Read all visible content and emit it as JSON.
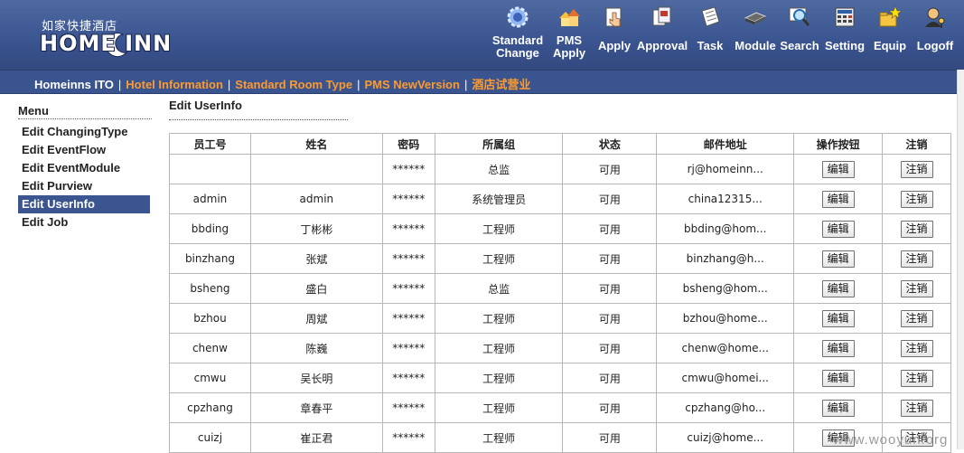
{
  "header": {
    "logo_cn": "如家快捷酒店",
    "logo_en": "HOME INN",
    "nav": [
      {
        "label": "Standard\nChange",
        "icon": "gear-icon"
      },
      {
        "label": "PMS\nApply",
        "icon": "houses-icon"
      },
      {
        "label": "Apply",
        "icon": "hand-pointer-icon"
      },
      {
        "label": "Approval",
        "icon": "documents-icon"
      },
      {
        "label": "Task",
        "icon": "notepad-icon"
      },
      {
        "label": "Module",
        "icon": "chip-icon"
      },
      {
        "label": "Search",
        "icon": "magnifier-icon"
      },
      {
        "label": "Setting",
        "icon": "calculator-icon"
      },
      {
        "label": "Equip",
        "icon": "folder-star-icon"
      },
      {
        "label": "Logoff",
        "icon": "user-key-icon"
      }
    ]
  },
  "subnav": {
    "items": [
      {
        "label": "Homeinns ITO",
        "style": "white"
      },
      {
        "label": "Hotel Information",
        "style": "orange"
      },
      {
        "label": "Standard Room Type",
        "style": "orange"
      },
      {
        "label": "PMS NewVersion",
        "style": "orange"
      },
      {
        "label": "酒店试营业",
        "style": "orange"
      }
    ],
    "separator": "|"
  },
  "menu": {
    "title": "Menu",
    "items": [
      "Edit ChangingType",
      "Edit EventFlow",
      "Edit EventModule",
      "Edit Purview",
      "Edit UserInfo",
      "Edit Job"
    ],
    "active_index": 4
  },
  "main": {
    "title": "Edit UserInfo",
    "columns": [
      "员工号",
      "姓名",
      "密码",
      "所属组",
      "状态",
      "邮件地址",
      "操作按钮",
      "注销"
    ],
    "edit_label": "编辑",
    "logout_label": "注销",
    "rows": [
      {
        "id": "",
        "name": "",
        "password": "******",
        "group": "总监",
        "status": "可用",
        "email": "rj@homeinn..."
      },
      {
        "id": "admin",
        "name": "admin",
        "password": "******",
        "group": "系统管理员",
        "status": "可用",
        "email": "china12315..."
      },
      {
        "id": "bbding",
        "name": "丁彬彬",
        "password": "******",
        "group": "工程师",
        "status": "可用",
        "email": "bbding@hom..."
      },
      {
        "id": "binzhang",
        "name": "张斌",
        "password": "******",
        "group": "工程师",
        "status": "可用",
        "email": "binzhang@h..."
      },
      {
        "id": "bsheng",
        "name": "盛白",
        "password": "******",
        "group": "总监",
        "status": "可用",
        "email": "bsheng@hom..."
      },
      {
        "id": "bzhou",
        "name": "周斌",
        "password": "******",
        "group": "工程师",
        "status": "可用",
        "email": "bzhou@home..."
      },
      {
        "id": "chenw",
        "name": "陈巍",
        "password": "******",
        "group": "工程师",
        "status": "可用",
        "email": "chenw@home..."
      },
      {
        "id": "cmwu",
        "name": "吴长明",
        "password": "******",
        "group": "工程师",
        "status": "可用",
        "email": "cmwu@homei..."
      },
      {
        "id": "cpzhang",
        "name": "章春平",
        "password": "******",
        "group": "工程师",
        "status": "可用",
        "email": "cpzhang@ho..."
      },
      {
        "id": "cuizj",
        "name": "崔正君",
        "password": "******",
        "group": "工程师",
        "status": "可用",
        "email": "cuizj@home..."
      }
    ]
  },
  "watermark": "www.wooyun.org"
}
